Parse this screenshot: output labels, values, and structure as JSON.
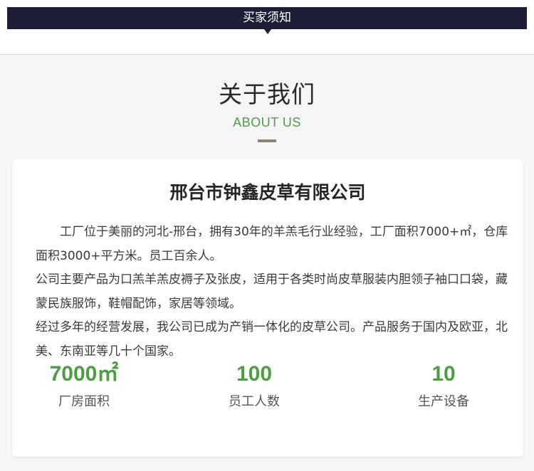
{
  "header": {
    "notice_label": "买家须知"
  },
  "about": {
    "title": "关于我们",
    "subtitle": "ABOUT US"
  },
  "company": {
    "name": "邢台市钟鑫皮草有限公司",
    "paragraphs": [
      "工厂位于美丽的河北-邢台，拥有30年的羊羔毛行业经验，工厂面积7000+㎡，仓库面积3000+平方米。员工百余人。",
      "公司主要产品为口羔羊羔皮褥子及张皮，适用于各类时尚皮草服装内胆领子袖口口袋，藏蒙民族服饰，鞋帽配饰，家居等领域。",
      "经过多年的经营发展，我公司已成为产销一体化的皮草公司。产品服务于国内及欧亚，北美、东南亚等几十个国家。"
    ]
  },
  "stats": [
    {
      "value": "7000㎡",
      "label": "厂房面积"
    },
    {
      "value": "100",
      "label": "员工人数"
    },
    {
      "value": "10",
      "label": "生产设备"
    }
  ],
  "colors": {
    "notice_bar": "#1c1e36",
    "accent_green": "#4f9d45",
    "background": "#f5f5f5"
  }
}
